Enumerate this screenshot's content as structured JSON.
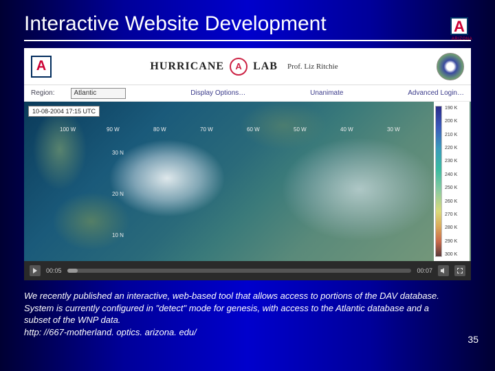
{
  "title": "Interactive Website Development",
  "logo": {
    "arizona_text": "ARIZONA",
    "letter": "A"
  },
  "app": {
    "brand_letter": "A",
    "lab_word1": "HURRICANE",
    "lab_word2": "LAB",
    "swirl_letter": "A",
    "prof": "Prof. Liz Ritchie"
  },
  "toolbar": {
    "region_label": "Region:",
    "region_value": "Atlantic",
    "display_options": "Display Options…",
    "unanimate": "Unanimate",
    "advanced_login": "Advanced Login…"
  },
  "map": {
    "timestamp": "10-08-2004 17:15 UTC",
    "lon_labels": [
      "100 W",
      "90 W",
      "80 W",
      "70 W",
      "60 W",
      "50 W",
      "40 W",
      "30 W"
    ],
    "lat_labels": [
      "30 N",
      "20 N",
      "10 N"
    ]
  },
  "colorbar": {
    "ticks": [
      "190 K",
      "200 K",
      "210 K",
      "220 K",
      "230 K",
      "240 K",
      "250 K",
      "260 K",
      "270 K",
      "280 K",
      "290 K",
      "300 K"
    ]
  },
  "player": {
    "elapsed": "00:05",
    "total": "00:07"
  },
  "caption": "We recently published an interactive, web-based tool that allows access to portions of the DAV database.  System is currently configured in \"detect\" mode for genesis, with access to the Atlantic database and a subset of the WNP data.\nhttp: //667-motherland. optics. arizona. edu/",
  "page_number": "35"
}
